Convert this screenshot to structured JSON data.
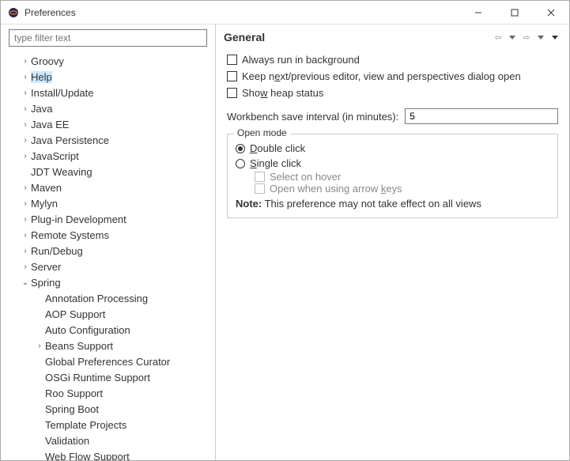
{
  "window": {
    "title": "Preferences"
  },
  "filter": {
    "placeholder": "type filter text"
  },
  "tree": [
    {
      "label": "Groovy",
      "indent": 1,
      "expander": ">"
    },
    {
      "label": "Help",
      "indent": 1,
      "expander": ">",
      "selected": true
    },
    {
      "label": "Install/Update",
      "indent": 1,
      "expander": ">"
    },
    {
      "label": "Java",
      "indent": 1,
      "expander": ">"
    },
    {
      "label": "Java EE",
      "indent": 1,
      "expander": ">"
    },
    {
      "label": "Java Persistence",
      "indent": 1,
      "expander": ">"
    },
    {
      "label": "JavaScript",
      "indent": 1,
      "expander": ">"
    },
    {
      "label": "JDT Weaving",
      "indent": 1,
      "expander": ""
    },
    {
      "label": "Maven",
      "indent": 1,
      "expander": ">"
    },
    {
      "label": "Mylyn",
      "indent": 1,
      "expander": ">"
    },
    {
      "label": "Plug-in Development",
      "indent": 1,
      "expander": ">"
    },
    {
      "label": "Remote Systems",
      "indent": 1,
      "expander": ">"
    },
    {
      "label": "Run/Debug",
      "indent": 1,
      "expander": ">"
    },
    {
      "label": "Server",
      "indent": 1,
      "expander": ">"
    },
    {
      "label": "Spring",
      "indent": 1,
      "expander": "v"
    },
    {
      "label": "Annotation Processing",
      "indent": 2,
      "expander": ""
    },
    {
      "label": "AOP Support",
      "indent": 2,
      "expander": ""
    },
    {
      "label": "Auto Configuration",
      "indent": 2,
      "expander": ""
    },
    {
      "label": "Beans Support",
      "indent": 2,
      "expander": ">"
    },
    {
      "label": "Global Preferences Curator",
      "indent": 2,
      "expander": ""
    },
    {
      "label": "OSGi Runtime Support",
      "indent": 2,
      "expander": ""
    },
    {
      "label": "Roo Support",
      "indent": 2,
      "expander": ""
    },
    {
      "label": "Spring Boot",
      "indent": 2,
      "expander": ""
    },
    {
      "label": "Template Projects",
      "indent": 2,
      "expander": ""
    },
    {
      "label": "Validation",
      "indent": 2,
      "expander": ""
    },
    {
      "label": "Web Flow Support",
      "indent": 2,
      "expander": ""
    }
  ],
  "page": {
    "heading": "General",
    "checkboxes": {
      "always_run": "Always run in background",
      "keep_next": "Keep next/previous editor, view and perspectives dialog open",
      "show_heap": "Show heap status"
    },
    "save_interval_label": "Workbench save interval (in minutes):",
    "save_interval_value": "5",
    "open_mode": {
      "legend": "Open mode",
      "double_click": "Double click",
      "single_click": "Single click",
      "select_hover": "Select on hover",
      "open_arrow": "Open when using arrow keys"
    },
    "note_prefix": "Note:",
    "note_text": " This preference may not take effect on all views"
  }
}
